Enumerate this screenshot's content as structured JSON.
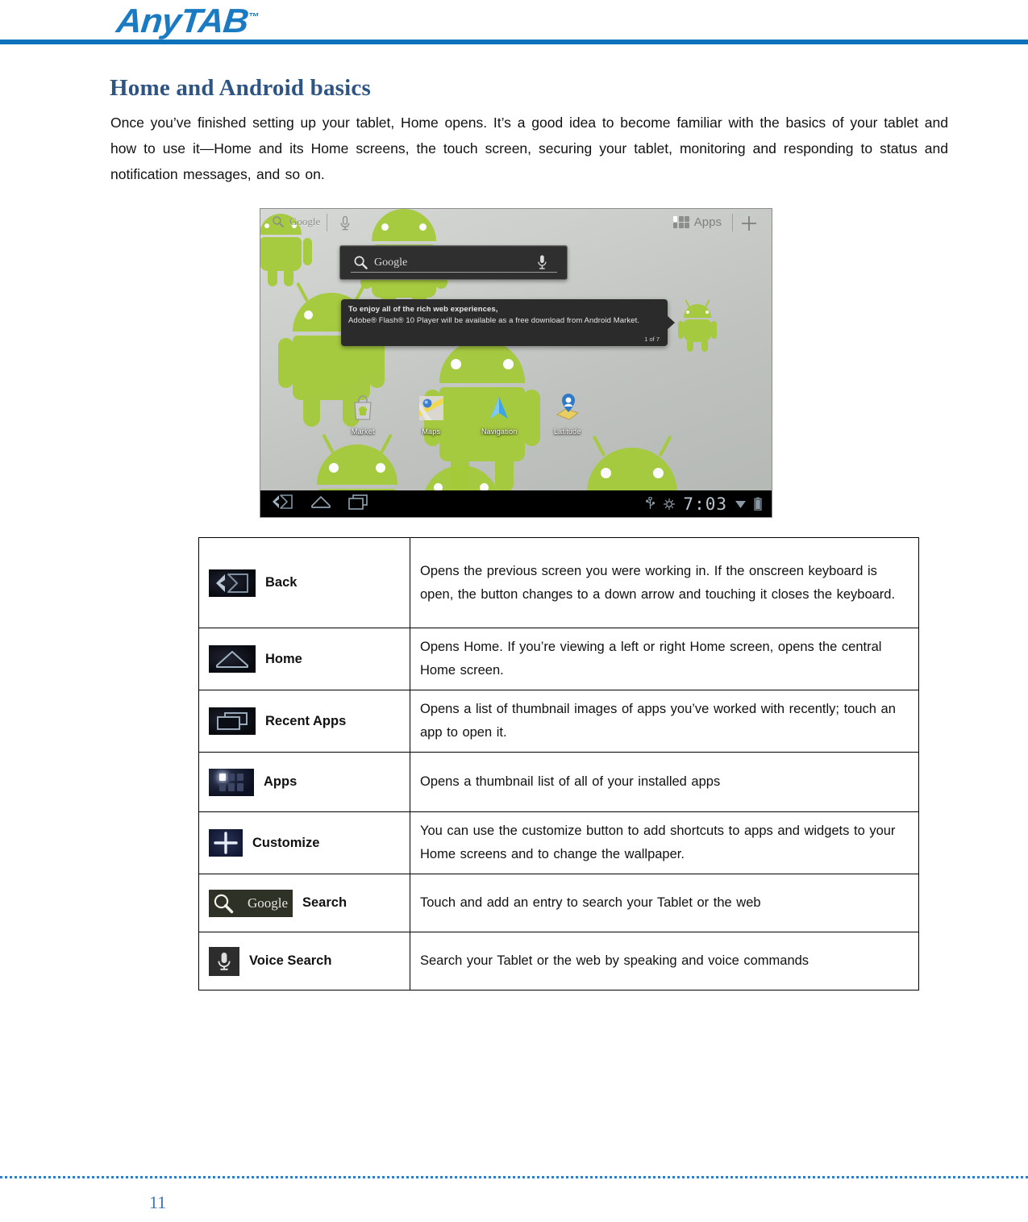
{
  "header": {
    "brand": "AnyTAB",
    "brand_tm": "™",
    "accent_color": "#0b72bb"
  },
  "document": {
    "title": "Home and Android basics",
    "title_color": "#2e5484",
    "intro": "Once  you’ve finished setting up  your tablet, Home  opens.  It’s  a  good  idea  to become familiar   with  the  basics of  your tablet   and   how to  use   it—Home   and   its Home  screens, the  touch screen, securing   your  tablet, monitoring   and   responding to  status and  notification messages,  and  so  on.",
    "page_number": "11"
  },
  "tablet_screenshot": {
    "topbar": {
      "google_label": "Google",
      "apps_label": "Apps",
      "search_icon": "search-icon",
      "mic_icon": "microphone-icon",
      "apps_icon": "apps-grid-icon",
      "plus_icon": "plus-icon"
    },
    "search_widget": {
      "label": "Google",
      "search_icon": "search-icon",
      "mic_icon": "microphone-icon"
    },
    "toast": {
      "line1": "To enjoy all of the rich web experiences,",
      "line2": "Adobe® Flash® 10 Player will be available as a free download from Android Market.",
      "counter": "1 of 7"
    },
    "shortcuts": [
      {
        "label": "Market",
        "icon": "market-bag-icon"
      },
      {
        "label": "Maps",
        "icon": "maps-icon"
      },
      {
        "label": "Navigation",
        "icon": "navigation-arrow-icon"
      },
      {
        "label": "Latitude",
        "icon": "latitude-icon"
      }
    ],
    "system_bar": {
      "back_icon": "back-icon",
      "home_icon": "home-icon",
      "recent_apps_icon": "recent-apps-icon",
      "usb_icon": "usb-icon",
      "sync_icon": "sync-icon",
      "clock": "7:03",
      "wifi_icon": "wifi-icon",
      "battery_icon": "battery-icon"
    }
  },
  "reference_table": {
    "rows": [
      {
        "icon": "back-icon",
        "label": "Back",
        "description": "Opens  the  previous  screen you  were working in.  If the onscreen keyboard  is open, the  button changes to a down arrow and  touching it  closes the  keyboard."
      },
      {
        "icon": "home-icon",
        "label": "Home",
        "description": "Opens  Home.  If you’re viewing a left  or right  Home  screen, opens the  central Home  screen."
      },
      {
        "icon": "recent-apps-icon",
        "label": "Recent Apps",
        "description": "Opens  a  list  of thumbnail images  of apps you’ve worked with recently; touch an  app  to  open  it."
      },
      {
        "icon": "apps-grid-icon",
        "label": "Apps",
        "description": "Opens  a thumbnail list of all of your installed apps"
      },
      {
        "icon": "plus-icon",
        "label": "Customize",
        "description": "You can use the customize button to add shortcuts to apps and widgets to your Home screens and to change the wallpaper."
      },
      {
        "icon": "google-search-icon",
        "label": "Search",
        "description": "Touch and add an entry to search your Tablet or the web"
      },
      {
        "icon": "microphone-icon",
        "label": "Voice Search",
        "description": "Search your Tablet or the web by speaking and voice commands"
      }
    ]
  }
}
